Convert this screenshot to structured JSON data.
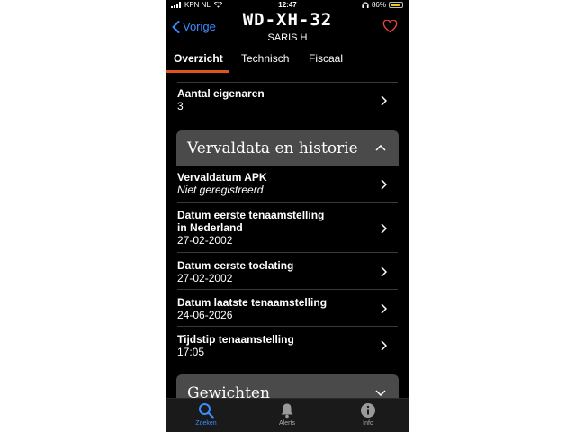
{
  "status_bar": {
    "carrier": "KPN NL",
    "time": "12:47",
    "battery_percent": "86%",
    "battery_level": 0.86
  },
  "header": {
    "back_label": "Vorige",
    "plate": "WD-XH-32",
    "model": "SARIS H",
    "favorite_icon": "heart-icon"
  },
  "tabs": [
    "Overzicht",
    "Technisch",
    "Fiscaal"
  ],
  "active_tab": "Overzicht",
  "owners_row": {
    "label": "Aantal eigenaren",
    "value": "3"
  },
  "sections": {
    "vervaldata": {
      "title": "Vervaldata en historie",
      "rows": [
        {
          "label": "Vervaldatum APK",
          "value": "Niet geregistreerd"
        },
        {
          "label1": "Datum eerste tenaamstelling",
          "label2": "in Nederland",
          "value": "27-02-2002"
        },
        {
          "label": "Datum eerste toelating",
          "value": "27-02-2002"
        },
        {
          "label": "Datum laatste tenaamstelling",
          "value": "24-06-2026"
        },
        {
          "label": "Tijdstip tenaamstelling",
          "value": "17:05"
        }
      ]
    },
    "gewichten": {
      "title": "Gewichten"
    }
  },
  "bottom_nav": [
    {
      "label": "Zoeken",
      "icon": "search-icon"
    },
    {
      "label": "Alerts",
      "icon": "bell-icon"
    },
    {
      "label": "Info",
      "icon": "info-icon"
    }
  ],
  "colors": {
    "accent": "#3a8dff",
    "tab_underline": "#e0521f",
    "heart": "#e0443a",
    "section_header": "#4a4a4a",
    "battery": "#f5c518"
  }
}
